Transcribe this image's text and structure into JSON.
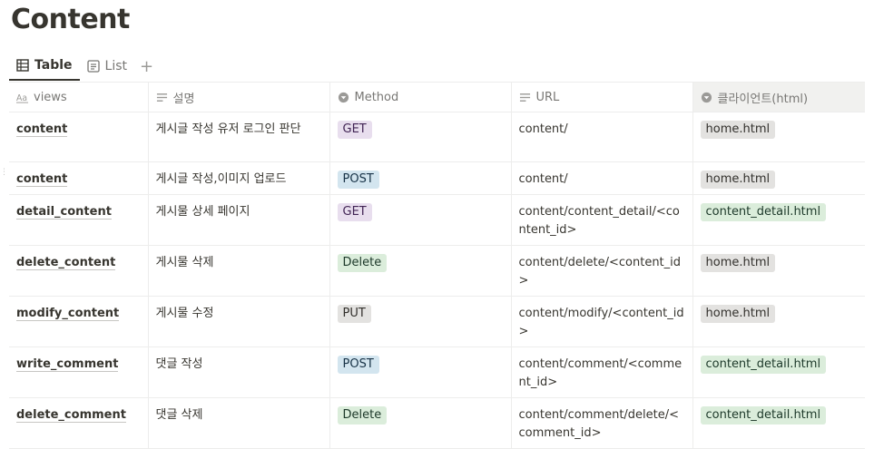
{
  "page": {
    "title": "Content"
  },
  "views": {
    "tabs": [
      {
        "label": "Table",
        "icon": "table-icon",
        "active": true
      },
      {
        "label": "List",
        "icon": "list-icon",
        "active": false
      }
    ],
    "add": "+"
  },
  "table": {
    "columns": [
      {
        "label": "views",
        "icon": "text-aa-icon"
      },
      {
        "label": "설명",
        "icon": "text-lines-icon"
      },
      {
        "label": "Method",
        "icon": "select-icon"
      },
      {
        "label": "URL",
        "icon": "text-lines-icon"
      },
      {
        "label": "클라이언트(html)",
        "icon": "select-icon"
      }
    ],
    "rows": [
      {
        "name": "content",
        "desc": "게시글 작성 유저 로그인 판단",
        "method": "GET",
        "method_color": "purple",
        "url": "content/",
        "client": "home.html",
        "client_color": "gray"
      },
      {
        "name": "content",
        "desc": "게시글 작성,이미지 업로드",
        "method": "POST",
        "method_color": "blue",
        "url": "content/",
        "client": "home.html",
        "client_color": "gray"
      },
      {
        "name": "detail_content",
        "desc": "게시물 상세 페이지",
        "method": "GET",
        "method_color": "purple",
        "url": "content/content_detail/<content_id>",
        "client": "content_detail.html",
        "client_color": "green"
      },
      {
        "name": "delete_content",
        "desc": "게시물 삭제",
        "method": "Delete",
        "method_color": "green",
        "url": "content/delete/<content_id>",
        "client": "home.html",
        "client_color": "gray"
      },
      {
        "name": "modify_content",
        "desc": "게시물 수정",
        "method": "PUT",
        "method_color": "gray",
        "url": "content/modify/<content_id>",
        "client": "home.html",
        "client_color": "gray"
      },
      {
        "name": "write_comment",
        "desc": "댓글 작성",
        "method": "POST",
        "method_color": "blue",
        "url": "content/comment/<comment_id>",
        "client": "content_detail.html",
        "client_color": "green"
      },
      {
        "name": "delete_comment",
        "desc": "댓글 삭제",
        "method": "Delete",
        "method_color": "green",
        "url": "content/comment/delete/<comment_id>",
        "client": "content_detail.html",
        "client_color": "green"
      }
    ]
  }
}
